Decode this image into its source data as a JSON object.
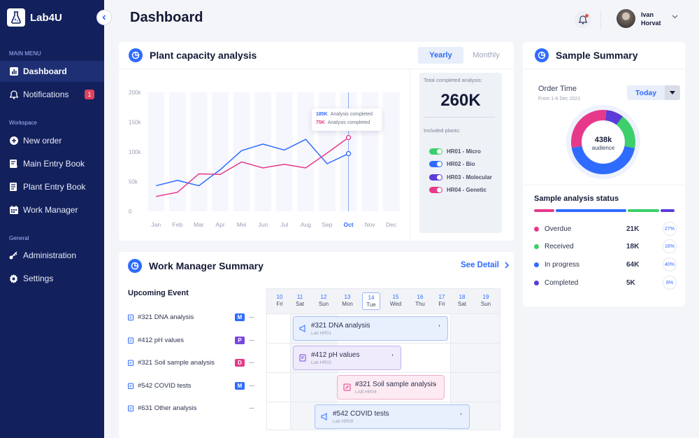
{
  "app": {
    "name": "Lab4U",
    "page_title": "Dashboard"
  },
  "user": {
    "name": "Ivan Horvat"
  },
  "sidebar": {
    "sections": {
      "main": "MAIN MENU",
      "workspace": "Workspace",
      "general": "General"
    },
    "items": [
      {
        "label": "Dashboard",
        "icon": "chart-icon",
        "active": true
      },
      {
        "label": "Notifications",
        "icon": "bell-icon",
        "badge": "1"
      },
      {
        "label": "New order",
        "icon": "plus-circle-icon"
      },
      {
        "label": "Main Entry Book",
        "icon": "book-icon"
      },
      {
        "label": "Plant Entry Book",
        "icon": "document-icon"
      },
      {
        "label": "Work Manager",
        "icon": "calendar-icon"
      },
      {
        "label": "Administration",
        "icon": "key-icon"
      },
      {
        "label": "Settings",
        "icon": "gear-icon"
      }
    ]
  },
  "plant": {
    "title": "Plant capacity analysis",
    "toggle": {
      "yearly": "Yearly",
      "monthly": "Monthly"
    },
    "total_label": "Total completed analysis:",
    "total_value": "260K",
    "plants_label": "Included plants:",
    "plants": [
      {
        "label": "HR01 - Micro",
        "color": "#3ccf6a"
      },
      {
        "label": "HR02 - Bio",
        "color": "#2f6bff"
      },
      {
        "label": "HR03 - Molecular",
        "color": "#5b3bd9"
      },
      {
        "label": "HR04 - Genetic",
        "color": "#e6398a"
      }
    ],
    "tooltip": [
      {
        "value": "185K",
        "text": "Analysis completed",
        "color": "#2f6bff"
      },
      {
        "value": "75K",
        "text": "Analysis completed",
        "color": "#e6398a"
      }
    ]
  },
  "chart_data": {
    "type": "line",
    "categories": [
      "Jan",
      "Feb",
      "Mar",
      "Apr",
      "Mei",
      "Jun",
      "Jul",
      "Aug",
      "Sep",
      "Oct",
      "Nov",
      "Dec"
    ],
    "y_ticks": [
      "0",
      "50k",
      "100k",
      "150k",
      "200k"
    ],
    "ylim": [
      0,
      200000
    ],
    "highlight_category": "Oct",
    "series": [
      {
        "color": "#2f6bff",
        "values": [
          43000,
          52000,
          43000,
          70000,
          102000,
          113000,
          103000,
          121000,
          80000,
          97000
        ]
      },
      {
        "color": "#e6398a",
        "values": [
          25000,
          32000,
          63000,
          62000,
          83000,
          73000,
          79000,
          73000,
          98000,
          124000
        ]
      }
    ]
  },
  "work": {
    "title": "Work Manager Summary",
    "see_detail": "See Detail",
    "upcoming_title": "Upcoming Event",
    "events": [
      {
        "label": "#321 DNA analysis",
        "tag": "M",
        "tag_color": "#2f6bff"
      },
      {
        "label": "#412 pH values",
        "tag": "P",
        "tag_color": "#7a46e0"
      },
      {
        "label": "#321 Soil sample analysis",
        "tag": "D",
        "tag_color": "#e6398a"
      },
      {
        "label": "#542 COVID tests",
        "tag": "M",
        "tag_color": "#2f6bff"
      },
      {
        "label": "#631 Other analysis",
        "tag": "",
        "tag_color": ""
      }
    ],
    "days": [
      {
        "n": "10",
        "d": "Fri"
      },
      {
        "n": "11",
        "d": "Sat"
      },
      {
        "n": "12",
        "d": "Sun"
      },
      {
        "n": "13",
        "d": "Mon"
      },
      {
        "n": "14",
        "d": "Tue",
        "today": true
      },
      {
        "n": "15",
        "d": "Wed"
      },
      {
        "n": "16",
        "d": "Thu"
      },
      {
        "n": "17",
        "d": "Fri"
      },
      {
        "n": "18",
        "d": "Sat"
      },
      {
        "n": "19",
        "d": "Sun"
      }
    ],
    "tasks": [
      {
        "name": "#321 DNA analysis",
        "sub": "Lab HR01"
      },
      {
        "name": "#412 pH values",
        "sub": "Lab HR02"
      },
      {
        "name": "#321 Soil sample analysis",
        "sub": "LAB HR04"
      },
      {
        "name": "#542 COVID tests",
        "sub": "Lab HR09"
      }
    ]
  },
  "sample": {
    "title": "Sample Summary",
    "order_time": "Order Time",
    "order_range": "From 1-6 Dec 2021",
    "select_value": "Today",
    "donut_value": "438k",
    "donut_label": "audience",
    "status_title": "Sample analysis status",
    "statuses": [
      {
        "label": "Overdue",
        "value": "21K",
        "pct": "27%",
        "color": "#e6398a"
      },
      {
        "label": "Received",
        "value": "18K",
        "pct": "16%",
        "color": "#3ccf6a"
      },
      {
        "label": "In progress",
        "value": "64K",
        "pct": "40%",
        "color": "#2f6bff"
      },
      {
        "label": "Completed",
        "value": "5K",
        "pct": "8%",
        "color": "#5b3bd9"
      }
    ]
  }
}
